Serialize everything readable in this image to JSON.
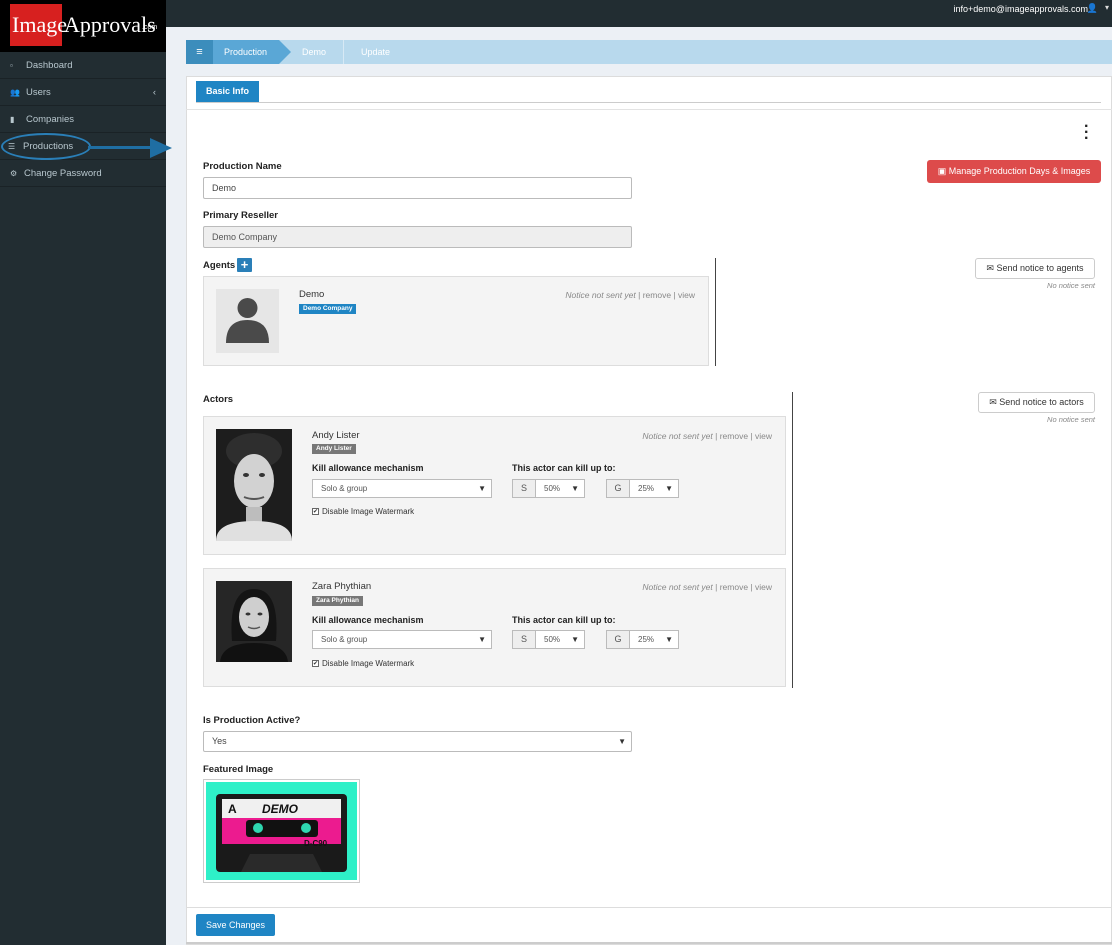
{
  "brand": {
    "logo_left": "Image",
    "logo_right": "Approvals",
    "logo_suffix": ".com"
  },
  "header": {
    "user_email": "info+demo@imageapprovals.com"
  },
  "sidebar": {
    "items": [
      {
        "label": "Dashboard",
        "icon": "dashboard-icon"
      },
      {
        "label": "Users",
        "icon": "users-icon"
      },
      {
        "label": "Companies",
        "icon": "building-icon"
      },
      {
        "label": "Productions",
        "icon": "list-icon"
      },
      {
        "label": "Change Password",
        "icon": "gear-icon"
      }
    ]
  },
  "breadcrumb": {
    "items": [
      "Production",
      "Demo",
      "Update"
    ]
  },
  "tabs": [
    {
      "label": "Basic Info",
      "active": true
    }
  ],
  "form": {
    "production_name_label": "Production Name",
    "production_name_value": "Demo",
    "primary_reseller_label": "Primary Reseller",
    "primary_reseller_value": "Demo Company",
    "manage_button": "Manage Production Days & Images",
    "agents_label": "Agents",
    "agents": [
      {
        "name": "Demo",
        "company": "Demo Company",
        "notice": "Notice not sent yet",
        "remove": "remove",
        "view": "view"
      }
    ],
    "send_agents_button": "Send notice to agents",
    "agents_no_notice": "No notice sent",
    "actors_label": "Actors",
    "send_actors_button": "Send notice to actors",
    "actors_no_notice": "No notice sent",
    "actors": [
      {
        "name": "Andy Lister",
        "tag": "Andy Lister",
        "notice": "Notice not sent yet",
        "remove": "remove",
        "view": "view",
        "kill_label": "Kill allowance mechanism",
        "kill_value": "Solo & group",
        "kill_up_label": "This actor can kill up to:",
        "s_label": "S",
        "s_value": "50%",
        "g_label": "G",
        "g_value": "25%",
        "watermark_label": "Disable Image Watermark",
        "watermark_checked": true
      },
      {
        "name": "Zara Phythian",
        "tag": "Zara Phythian",
        "notice": "Notice not sent yet",
        "remove": "remove",
        "view": "view",
        "kill_label": "Kill allowance mechanism",
        "kill_value": "Solo & group",
        "kill_up_label": "This actor can kill up to:",
        "s_label": "S",
        "s_value": "50%",
        "g_label": "G",
        "g_value": "25%",
        "watermark_label": "Disable Image Watermark",
        "watermark_checked": true
      }
    ],
    "active_label": "Is Production Active?",
    "active_value": "Yes",
    "featured_label": "Featured Image",
    "cassette_side": "A",
    "cassette_text": "DEMO",
    "cassette_model": "D-C90",
    "save_button": "Save Changes"
  }
}
